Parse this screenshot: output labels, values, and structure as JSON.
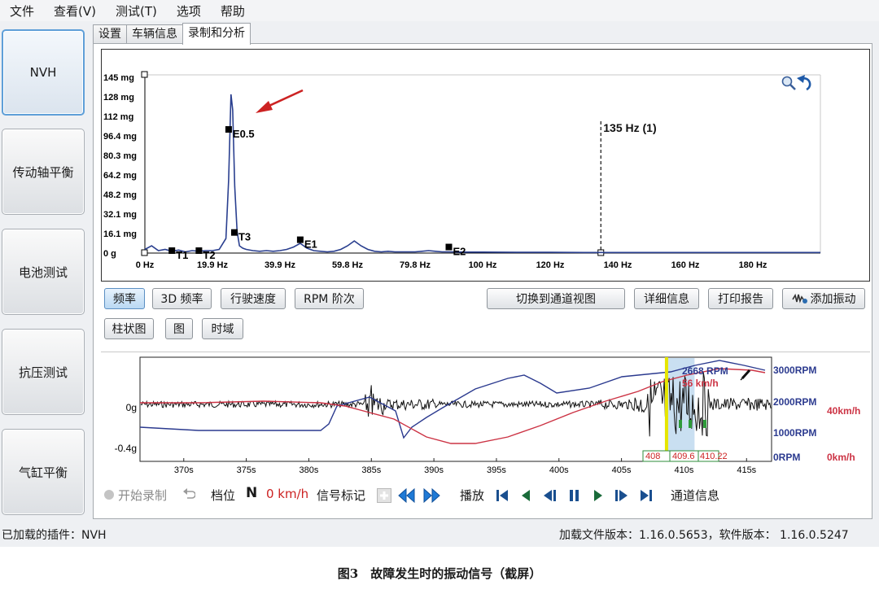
{
  "menu": [
    "文件",
    "查看(V)",
    "测试(T)",
    "选项",
    "帮助"
  ],
  "sidebar": {
    "items": [
      {
        "label": "NVH",
        "active": true
      },
      {
        "label": "传动轴平衡",
        "active": false
      },
      {
        "label": "电池测试",
        "active": false
      },
      {
        "label": "抗压测试",
        "active": false
      },
      {
        "label": "气缸平衡",
        "active": false
      }
    ]
  },
  "tabs": [
    {
      "label": "设置",
      "active": false
    },
    {
      "label": "车辆信息",
      "active": false
    },
    {
      "label": "录制和分析",
      "active": true
    }
  ],
  "spectrum": {
    "y_ticks": [
      "145 mg",
      "128 mg",
      "112 mg",
      "96.4 mg",
      "80.3 mg",
      "64.2 mg",
      "48.2 mg",
      "32.1 mg",
      "16.1 mg",
      "0 g"
    ],
    "x_ticks": [
      "0 Hz",
      "19.9 Hz",
      "39.9 Hz",
      "59.8 Hz",
      "79.8 Hz",
      "100 Hz",
      "120 Hz",
      "140 Hz",
      "160 Hz",
      "180 Hz"
    ],
    "cursor_label": "135 Hz (1)",
    "markers": [
      {
        "label": "E0.5"
      },
      {
        "label": "T1"
      },
      {
        "label": "T2"
      },
      {
        "label": "T3"
      },
      {
        "label": "E1"
      },
      {
        "label": "E2"
      }
    ],
    "colors": {
      "trace": "#2a3f8f",
      "arrow": "#cc2222"
    }
  },
  "chart_data": {
    "type": "line",
    "title": "",
    "xlabel": "",
    "ylabel": "",
    "xlim": [
      0,
      200
    ],
    "ylim": [
      0,
      145
    ],
    "series": [
      {
        "x": [
          0,
          2,
          4,
          6,
          8,
          10,
          12,
          14,
          16,
          18,
          20,
          22,
          24,
          24.8,
          25.5,
          26,
          26.6,
          27.3,
          28,
          29,
          30,
          32,
          34,
          36,
          38,
          40,
          42,
          44,
          46,
          48,
          50,
          52,
          54,
          56,
          58,
          60,
          62,
          64,
          66,
          68,
          70,
          72,
          74,
          76,
          78,
          80,
          82,
          84,
          86,
          88,
          90,
          95,
          100,
          110,
          120,
          130,
          140,
          150,
          160,
          170,
          180,
          190,
          200
        ],
        "y": [
          3,
          6,
          2,
          3,
          1.5,
          2.5,
          1,
          2,
          1.5,
          2,
          2,
          3,
          12,
          60,
          131,
          118,
          55,
          18,
          6,
          4,
          3,
          2,
          1.5,
          2,
          1.5,
          2,
          3,
          5,
          8,
          4,
          2,
          1.5,
          1,
          1.5,
          3,
          6,
          10,
          6,
          3,
          1.5,
          1,
          1.5,
          1,
          1,
          1,
          1,
          1.5,
          2,
          1.5,
          1,
          1,
          0.8,
          0.8,
          0.6,
          0.6,
          0.5,
          0.5,
          0.5,
          0.5,
          0.5,
          0.5,
          0.5,
          0.5
        ]
      }
    ],
    "markers": [
      {
        "label": "E0.5",
        "x": 24.8,
        "y": 102
      },
      {
        "label": "T1",
        "x": 8,
        "y": 2
      },
      {
        "label": "T2",
        "x": 16,
        "y": 2
      },
      {
        "label": "T3",
        "x": 26.5,
        "y": 17
      },
      {
        "label": "E1",
        "x": 46,
        "y": 11
      },
      {
        "label": "E2",
        "x": 90,
        "y": 5
      }
    ],
    "cursor_x": 135
  },
  "view_buttons": {
    "freq": "频率",
    "freq3d": "3D 频率",
    "speed": "行驶速度",
    "rpm_order": "RPM 阶次",
    "switch": "切换到通道视图",
    "details": "详细信息",
    "print": "打印报告",
    "add_vib": "添加振动",
    "bar": "柱状图",
    "graph": "图",
    "time": "时域"
  },
  "timeline": {
    "y_labels": [
      "0g",
      "-0.4g"
    ],
    "x_ticks": [
      "370s",
      "375s",
      "380s",
      "385s",
      "390s",
      "395s",
      "400s",
      "405s",
      "410s",
      "415s"
    ],
    "rpm_ticks": [
      "3000RPM",
      "2000RPM",
      "1000RPM",
      "0RPM"
    ],
    "speed_ticks": [
      "40km/h",
      "0km/h"
    ],
    "rpm_readout": "2668 RPM",
    "speed_readout": "56 km/h",
    "sel_labels": [
      "408",
      "409.6",
      "410.22"
    ],
    "colors": {
      "vibration": "#111111",
      "rpm": "#2b3a8f",
      "speed": "#cc3344",
      "cursor": "#e6e600",
      "selection": "#bcd7ee"
    }
  },
  "toolbar": {
    "record": "开始录制",
    "gear_label": "档位",
    "gear_value": "N",
    "speed_value": "0 km/h",
    "signal_mark": "信号标记",
    "play": "播放",
    "channel_info": "通道信息"
  },
  "status": {
    "left": "已加载的插件：NVH",
    "right": "加载文件版本：1.16.0.5653，软件版本：  1.16.0.5247"
  },
  "caption": "图3　故障发生时的振动信号（截屏）"
}
